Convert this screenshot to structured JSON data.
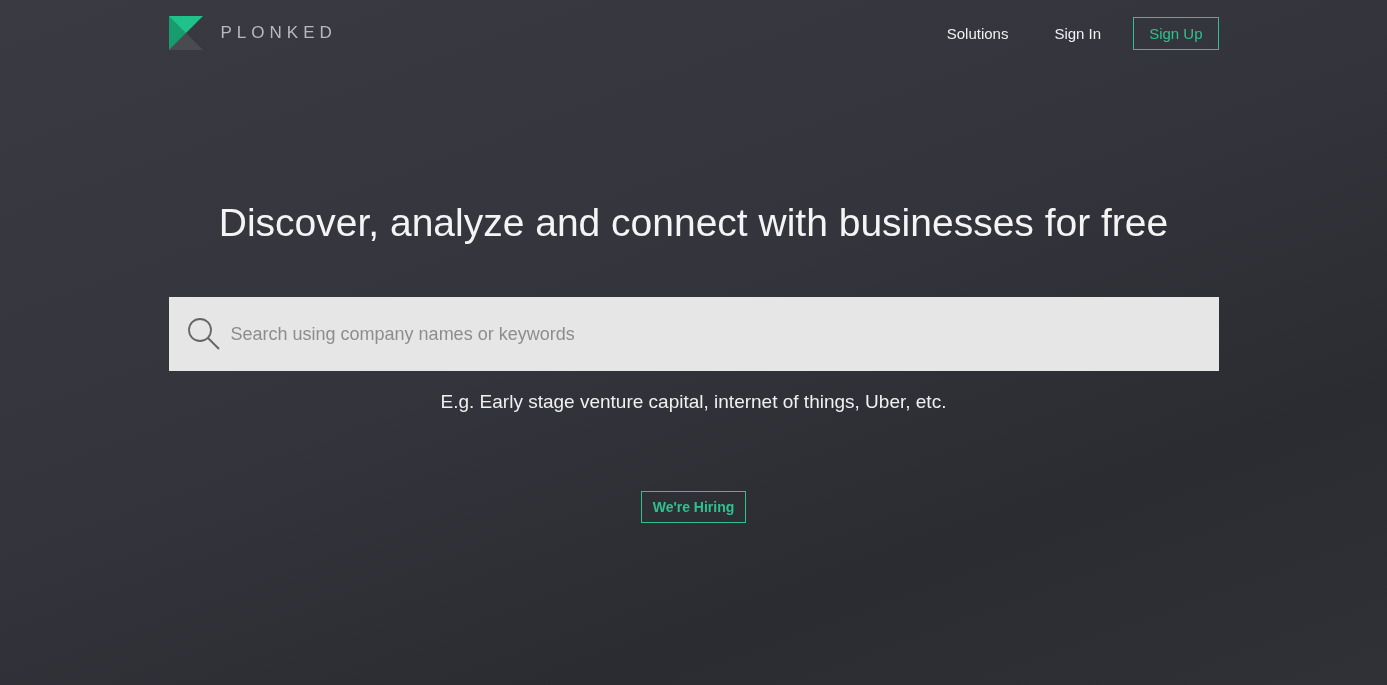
{
  "header": {
    "brand": "PLONKED",
    "nav": [
      {
        "label": "Solutions",
        "kind": "link"
      },
      {
        "label": "Sign In",
        "kind": "link"
      },
      {
        "label": "Sign Up",
        "kind": "button"
      }
    ]
  },
  "hero": {
    "headline": "Discover, analyze and connect with businesses for free",
    "search": {
      "placeholder": "Search using company names or keywords"
    },
    "example": "E.g. Early stage venture capital, internet of things, Uber, etc.",
    "cta": "We're Hiring"
  }
}
